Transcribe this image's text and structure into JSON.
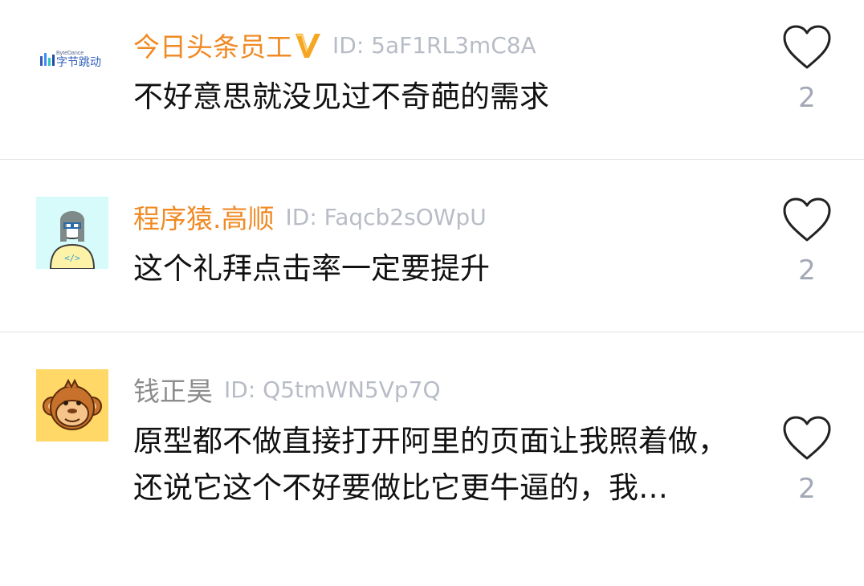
{
  "comments": [
    {
      "username": "今日头条员工",
      "verified": true,
      "user_id": "ID: 5aF1RL3mC8A",
      "text": "不好意思就没见过不奇葩的需求",
      "likes": "2",
      "avatar": "bytedance-logo",
      "avatar_text_small": "ByteDance",
      "avatar_text": "字节跳动"
    },
    {
      "username": "程序猿.高顺",
      "verified": false,
      "user_id": "ID: Faqcb2sOWpU",
      "text": "这个礼拜点击率一定要提升",
      "likes": "2",
      "avatar": "programmer-avatar",
      "avatar_code": "</>"
    },
    {
      "username": "钱正昊",
      "verified": false,
      "user_id": "ID: Q5tmWN5Vp7Q",
      "text": "原型都不做直接打开阿里的页面让我照着做，还说它这个不好要做比它更牛逼的，我…",
      "likes": "2",
      "avatar": "monkey-avatar"
    }
  ],
  "colors": {
    "username_highlight": "#f08a24",
    "username_plain": "#8c8c8c",
    "user_id": "#b8bcc6",
    "like_count": "#a2a8b5",
    "verified_badge": "#f5a623"
  }
}
